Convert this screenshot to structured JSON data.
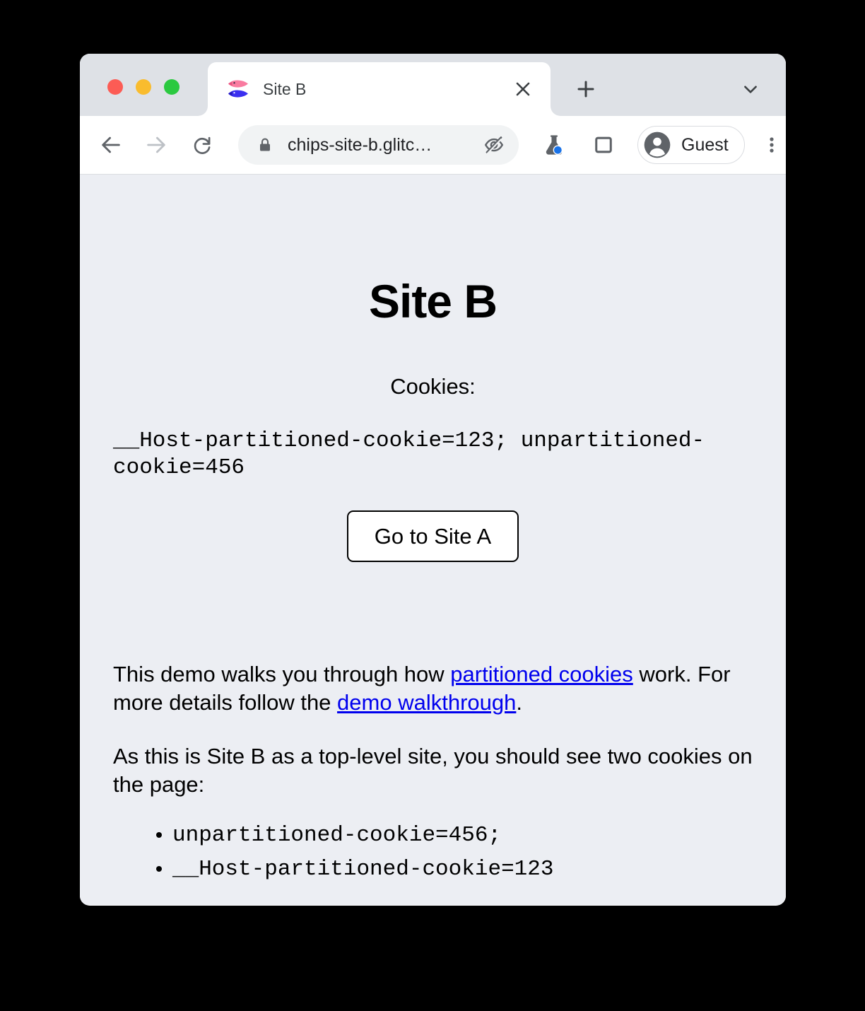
{
  "browser": {
    "window_controls": [
      {
        "name": "close",
        "color": "#fc5c55"
      },
      {
        "name": "minimize",
        "color": "#f9bc2e"
      },
      {
        "name": "maximize",
        "color": "#2bc940"
      }
    ],
    "tab": {
      "title": "Site B",
      "favicon": "two-fish-icon",
      "close_label": "×"
    },
    "new_tab_label": "+",
    "tab_list_icon": "chevron-down-icon",
    "toolbar": {
      "back_icon": "back-arrow-icon",
      "forward_icon": "forward-arrow-icon",
      "reload_icon": "reload-icon",
      "lock_icon": "lock-icon",
      "url": "chips-site-b.glitc…",
      "permission_icon": "eye-slash-icon",
      "flask_icon": "flask-icon",
      "side_panel_icon": "side-panel-icon",
      "profile_label": "Guest",
      "profile_icon": "account-circle-icon",
      "overflow_icon": "three-dots-icon",
      "accent_badge_color": "#1a73e8"
    }
  },
  "page": {
    "heading": "Site B",
    "cookies_label": "Cookies:",
    "cookie_string": "__Host-partitioned-cookie=123; unpartitioned-cookie=456",
    "go_to_site_a_label": "Go to Site A",
    "paragraph_intro": {
      "part1": "This demo walks you through how ",
      "link1": "partitioned cookies",
      "part2": " work. For more details follow the ",
      "link2": "demo walkthrough",
      "part3": "."
    },
    "paragraph_sitedesc": "As this is Site B as a top-level site, you should see two cookies on the page:",
    "cookie_list": [
      "unpartitioned-cookie=456;",
      "__Host-partitioned-cookie=123"
    ],
    "background_color": "#eceef3",
    "link_color": "#0000ee"
  }
}
